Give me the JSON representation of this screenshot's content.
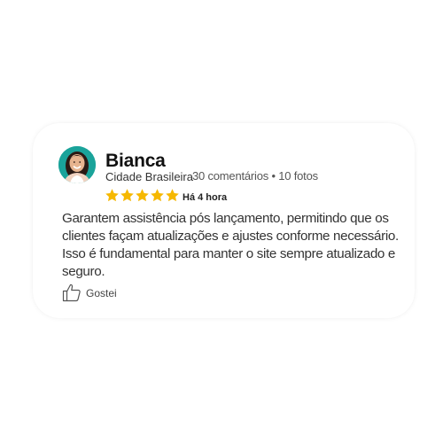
{
  "review": {
    "author_name": "Bianca",
    "location": "Cidade Brasileira",
    "author_stats": "30 comentários • 10 fotos",
    "rating": 5,
    "rating_max": 5,
    "timestamp": "Há 4 hora",
    "text": "Garantem assistência pós lançamento, permitindo que os clientes façam atualizações e ajustes conforme necessário. Isso é fundamental para manter o site sempre atualizado e seguro.",
    "like_label": "Gostei"
  },
  "icons": {
    "avatar": "avatar-photo",
    "star": "star-icon",
    "like": "thumbs-up-icon"
  },
  "colors": {
    "star": "#f6b800",
    "avatar_bg": "#1aa39a",
    "card_bg": "#ffffff",
    "text": "#333333"
  }
}
